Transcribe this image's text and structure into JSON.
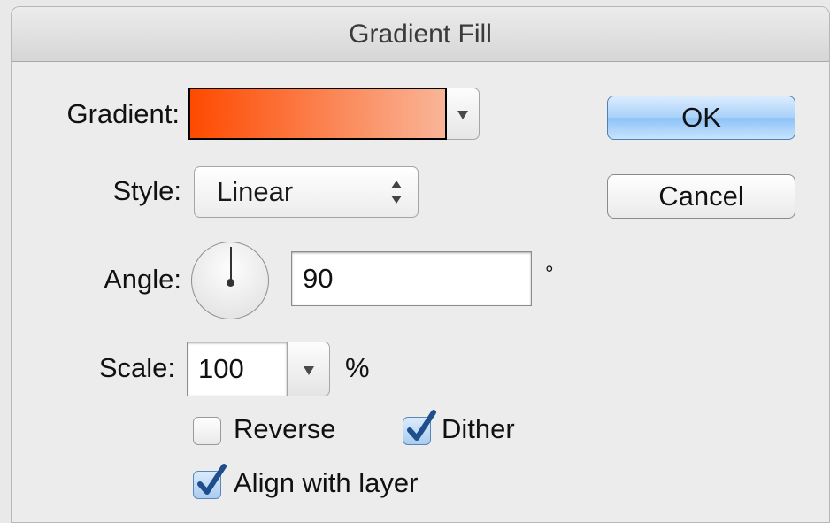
{
  "window": {
    "title": "Gradient Fill"
  },
  "form": {
    "gradient_label": "Gradient:",
    "style_label": "Style:",
    "style_value": "Linear",
    "angle_label": "Angle:",
    "angle_value": "90",
    "angle_unit": "°",
    "scale_label": "Scale:",
    "scale_value": "100",
    "scale_unit": "%"
  },
  "options": {
    "reverse": {
      "label": "Reverse",
      "checked": false
    },
    "dither": {
      "label": "Dither",
      "checked": true
    },
    "align": {
      "label": "Align with layer",
      "checked": true
    }
  },
  "buttons": {
    "ok": "OK",
    "cancel": "Cancel"
  },
  "colors": {
    "gradient_start": "#fe4a00",
    "gradient_end": "#f9b598",
    "check_accent": "#1e4f8c"
  },
  "icons": {
    "gradient_dropdown": "chevron-down-icon",
    "style_stepper": "up-down-arrows-icon",
    "scale_dropdown": "chevron-down-icon",
    "checkmark": "checkmark-icon"
  }
}
